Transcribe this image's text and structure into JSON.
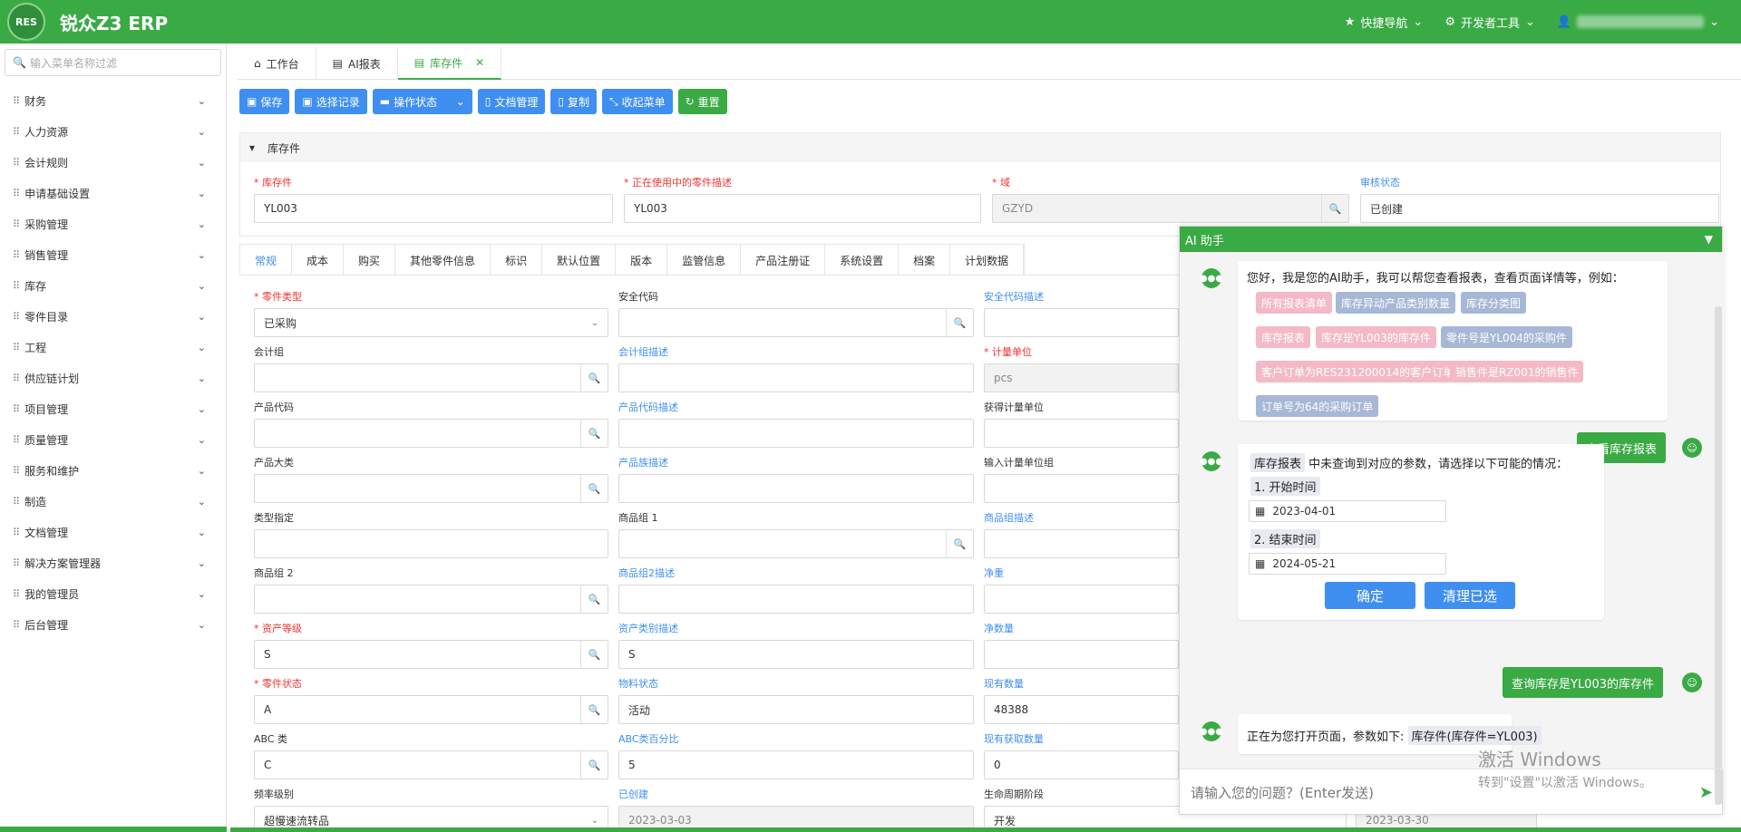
{
  "header": {
    "logo_text": "RES",
    "title": "锐众Z3 ERP",
    "quick_nav": "快捷导航",
    "dev_tools": "开发者工具"
  },
  "sidebar": {
    "search_placeholder": "输入菜单名称过滤",
    "items": [
      {
        "label": "财务"
      },
      {
        "label": "人力资源"
      },
      {
        "label": "会计规则"
      },
      {
        "label": "申请基础设置"
      },
      {
        "label": "采购管理"
      },
      {
        "label": "销售管理"
      },
      {
        "label": "库存"
      },
      {
        "label": "零件目录"
      },
      {
        "label": "工程"
      },
      {
        "label": "供应链计划"
      },
      {
        "label": "项目管理"
      },
      {
        "label": "质量管理"
      },
      {
        "label": "服务和维护"
      },
      {
        "label": "制造"
      },
      {
        "label": "文档管理"
      },
      {
        "label": "解决方案管理器"
      },
      {
        "label": "我的管理员"
      },
      {
        "label": "后台管理"
      }
    ]
  },
  "tabs": [
    {
      "label": "工作台"
    },
    {
      "label": "AI报表"
    },
    {
      "label": "库存件"
    }
  ],
  "toolbar": {
    "save": "保存",
    "select_record": "选择记录",
    "op_status": "操作状态",
    "doc_mgmt": "文档管理",
    "copy": "复制",
    "collapse_menu": "收起菜单",
    "reset": "重置"
  },
  "section": {
    "title": "库存件",
    "fields": {
      "part_label": "库存件",
      "part_value": "YL003",
      "desc_label": "正在使用中的零件描述",
      "desc_value": "YL003",
      "domain_label": "域",
      "domain_value": "GZYD",
      "audit_label": "审核状态",
      "audit_value": "已创建"
    }
  },
  "inner_tabs": [
    "常规",
    "成本",
    "购买",
    "其他零件信息",
    "标识",
    "默认位置",
    "版本",
    "监管信息",
    "产品注册证",
    "系统设置",
    "档案",
    "计划数据"
  ],
  "form": {
    "part_type_label": "零件类型",
    "part_type_value": "已采购",
    "safety_code_label": "安全代码",
    "safety_desc_label": "安全代码描述",
    "acct_group_label": "会计组",
    "acct_group_desc_label": "会计组描述",
    "uom_label": "计量单位",
    "uom_value": "pcs",
    "product_code_label": "产品代码",
    "product_code_desc_label": "产品代码描述",
    "get_uom_label": "获得计量单位",
    "product_family_label": "产品大类",
    "product_family_desc_label": "产品族描述",
    "input_uom_group_label": "输入计量单位组",
    "type_spec_label": "类型指定",
    "commodity1_label": "商品组 1",
    "commodity_group_desc_label": "商品组描述",
    "commodity2_label": "商品组 2",
    "commodity2_desc_label": "商品组2描述",
    "net_weight_label": "净重",
    "asset_class_label": "资产等级",
    "asset_class_value": "S",
    "asset_class_desc_label": "资产类别描述",
    "asset_class_desc_value": "S",
    "net_qty_label": "净数量",
    "part_status_label": "零件状态",
    "part_status_value": "A",
    "material_status_label": "物料状态",
    "material_status_value": "活动",
    "onhand_label": "现有数量",
    "onhand_value": "48388",
    "abc_label": "ABC 类",
    "abc_value": "C",
    "abc_pct_label": "ABC类百分比",
    "abc_pct_value": "5",
    "onhand_get_label": "现有获取数量",
    "onhand_get_value": "0",
    "freq_label": "频率级别",
    "freq_value": "超慢速流转品",
    "created_label": "已创建",
    "created_value": "2023-03-03",
    "lifecycle_label": "生命周期阶段",
    "lifecycle_value": "开发",
    "last_value": "2023-03-30"
  },
  "ai": {
    "title": "AI 助手",
    "greeting": "您好，我是您的AI助手，我可以帮您查看报表，查看页面详情等，例如：",
    "chips": [
      {
        "label": "所有报表清单",
        "color": "pink"
      },
      {
        "label": "库存异动产品类别数量",
        "color": "blue"
      },
      {
        "label": "库存分类图",
        "color": "blue"
      },
      {
        "label": "库存报表",
        "color": "pink"
      },
      {
        "label": "库存是YL003的库存件",
        "color": "pink"
      },
      {
        "label": "零件号是YL004的采购件",
        "color": "blue"
      },
      {
        "label": "客户订单为RES231200014的客户订单",
        "color": "pink"
      },
      {
        "label": "销售件是RZ001的销售件",
        "color": "pink"
      },
      {
        "label": "订单号为64的采购订单",
        "color": "blue"
      }
    ],
    "user_msg1": "查看库存报表",
    "reply_tag": "库存报表",
    "reply_text": "中未查询到对应的参数，请选择以下可能的情况：",
    "opt1_label": "1. 开始时间",
    "opt1_date": "2023-04-01",
    "opt2_label": "2. 结束时间",
    "opt2_date": "2024-05-21",
    "confirm": "确定",
    "clear": "清理已选",
    "user_msg2": "查询库存是YL003的库存件",
    "opening_text": "正在为您打开页面，参数如下:",
    "opening_tag": "库存件(库存件=YL003)",
    "input_placeholder": "请输入您的问题？(Enter发送)"
  },
  "watermark": {
    "line1": "激活 Windows",
    "line2": "转到\"设置\"以激活 Windows。"
  },
  "colors": {
    "brand_green": "#3aaa45",
    "button_blue": "#3f8ff0",
    "required_red": "#e33333",
    "chip_pink": "#f4b9c6",
    "chip_blue": "#a6b8d6"
  }
}
